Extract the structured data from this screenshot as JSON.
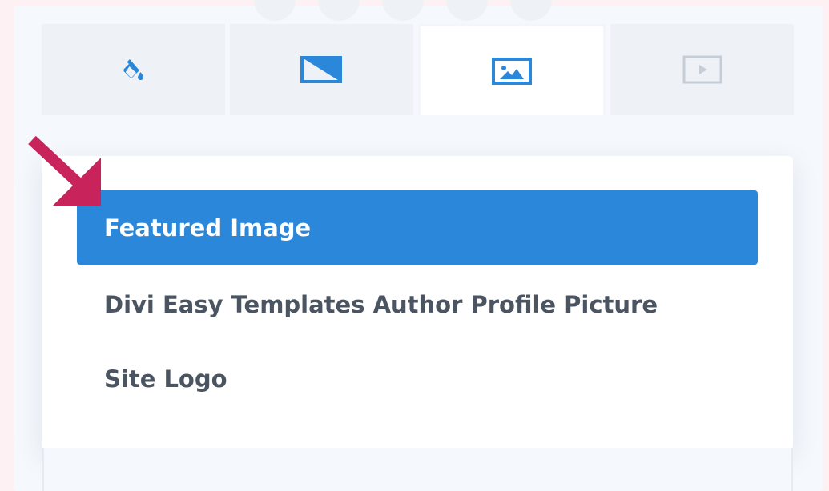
{
  "tabs": [
    {
      "icon": "paint-bucket-icon",
      "active": false
    },
    {
      "icon": "gradient-icon",
      "active": false
    },
    {
      "icon": "image-icon",
      "active": true
    },
    {
      "icon": "video-icon",
      "active": false
    }
  ],
  "dropdown": {
    "options": [
      {
        "label": "Featured Image",
        "selected": true
      },
      {
        "label": "Divi Easy Templates Author Profile Picture",
        "selected": false
      },
      {
        "label": "Site Logo",
        "selected": false
      }
    ]
  },
  "colors": {
    "accent": "#2b87da",
    "arrow": "#c8235b",
    "text": "#4b5562"
  }
}
